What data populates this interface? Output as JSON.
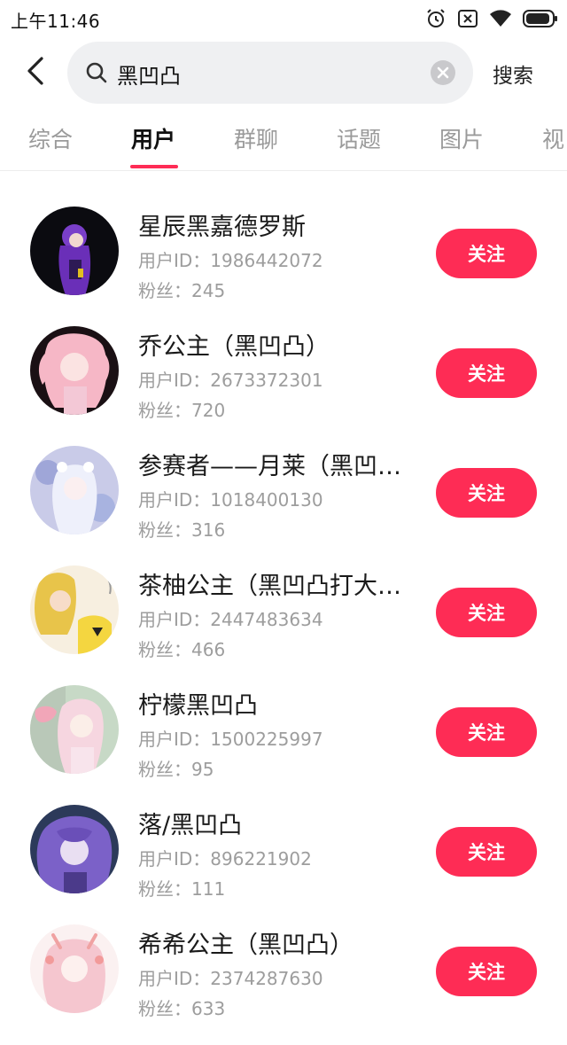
{
  "status_bar": {
    "time": "上午11:46",
    "icons": [
      "alarm-icon",
      "sim-off-icon",
      "wifi-icon",
      "battery-icon"
    ]
  },
  "search": {
    "query": "黑凹凸",
    "submit_label": "搜索"
  },
  "tabs": [
    {
      "label": "综合",
      "active": false
    },
    {
      "label": "用户",
      "active": true
    },
    {
      "label": "群聊",
      "active": false
    },
    {
      "label": "话题",
      "active": false
    },
    {
      "label": "图片",
      "active": false
    },
    {
      "label": "视",
      "active": false
    }
  ],
  "colors": {
    "accent": "#fe2c55",
    "search_bg": "#eff0f2",
    "secondary_text": "#9d9d9d"
  },
  "users": [
    {
      "name": "星辰黑嘉德罗斯",
      "uid": "用户ID：1986442072",
      "fans": "粉丝：245",
      "follow_label": "关注"
    },
    {
      "name": "乔公主（黑凹凸）",
      "uid": "用户ID：2673372301",
      "fans": "粉丝：720",
      "follow_label": "关注"
    },
    {
      "name": "参赛者——月莱（黑凹…",
      "uid": "用户ID：1018400130",
      "fans": "粉丝：316",
      "follow_label": "关注"
    },
    {
      "name": "茶柚公主（黑凹凸打大…",
      "uid": "用户ID：2447483634",
      "fans": "粉丝：466",
      "follow_label": "关注"
    },
    {
      "name": "柠檬黑凹凸",
      "uid": "用户ID：1500225997",
      "fans": "粉丝：95",
      "follow_label": "关注"
    },
    {
      "name": "落/黑凹凸",
      "uid": "用户ID：896221902",
      "fans": "粉丝：111",
      "follow_label": "关注"
    },
    {
      "name": "希希公主（黑凹凸）",
      "uid": "用户ID：2374287630",
      "fans": "粉丝：633",
      "follow_label": "关注"
    }
  ]
}
